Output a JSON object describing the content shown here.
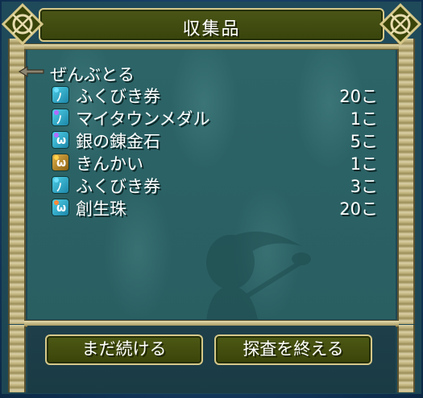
{
  "window": {
    "title": "収集品"
  },
  "list": {
    "header": "ぜんぶとる",
    "items": [
      {
        "name": "ふくびき券",
        "qty": "20こ",
        "icon": "ticket-icon",
        "color": "#2aa6c8",
        "gem": "#6fe0ff"
      },
      {
        "name": "マイタウンメダル",
        "qty": "1こ",
        "icon": "medal-ticket-icon",
        "color": "#2aa6c8",
        "gem": "#b36bff"
      },
      {
        "name": "銀の錬金石",
        "qty": "5こ",
        "icon": "alchemy-stone-icon",
        "color": "#2aa6c8",
        "gem": "#b36bff"
      },
      {
        "name": "きんかい",
        "qty": "1こ",
        "icon": "gold-bar-icon",
        "color": "#b8861c",
        "gem": "#ffd24a"
      },
      {
        "name": "ふくびき券",
        "qty": "3こ",
        "icon": "ticket-icon",
        "color": "#2aa6c8",
        "gem": "#6fe0ff"
      },
      {
        "name": "創生珠",
        "qty": "20こ",
        "icon": "creation-orb-icon",
        "color": "#2aa6c8",
        "gem": "#ff8a3a"
      }
    ]
  },
  "buttons": {
    "continue_label": "まだ続ける",
    "end_label": "探査を終える"
  }
}
